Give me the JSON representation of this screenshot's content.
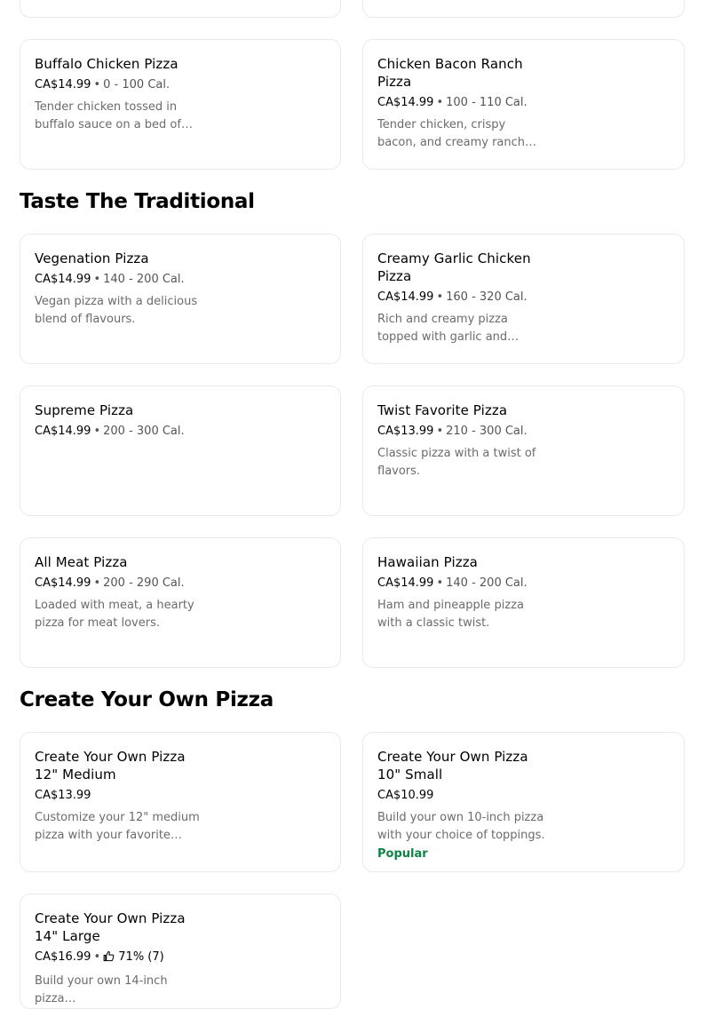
{
  "sections": {
    "traditional": {
      "title": "Taste The Traditional"
    },
    "create_own": {
      "title": "Create Your Own Pizza"
    }
  },
  "items": {
    "buffalo": {
      "name": "Buffalo Chicken Pizza",
      "price": "CA$14.99",
      "calories": "0 - 100 Cal.",
      "description": "Tender chicken tossed in buffalo sauce on a bed of…"
    },
    "bacon_ranch": {
      "name": "Chicken Bacon Ranch Pizza",
      "price": "CA$14.99",
      "calories": "100 - 110 Cal.",
      "description": "Tender chicken, crispy bacon, and creamy ranch…"
    },
    "vegenation": {
      "name": "Vegenation Pizza",
      "price": "CA$14.99",
      "calories": "140 - 200 Cal.",
      "description": "Vegan pizza with a delicious blend of flavours."
    },
    "creamy_garlic": {
      "name": "Creamy Garlic Chicken Pizza",
      "price": "CA$14.99",
      "calories": "160 - 320 Cal.",
      "description": "Rich and creamy pizza topped with garlic and…"
    },
    "supreme": {
      "name": "Supreme Pizza",
      "price": "CA$14.99",
      "calories": "200 - 300 Cal."
    },
    "twist": {
      "name": "Twist Favorite Pizza",
      "price": "CA$13.99",
      "calories": "210 - 300 Cal.",
      "description": "Classic pizza with a twist of flavors."
    },
    "all_meat": {
      "name": "All Meat Pizza",
      "price": "CA$14.99",
      "calories": "200 - 290 Cal.",
      "description": "Loaded with meat, a hearty pizza for meat lovers."
    },
    "hawaiian": {
      "name": "Hawaiian Pizza",
      "price": "CA$14.99",
      "calories": "140 - 200 Cal.",
      "description": "Ham and pineapple pizza with a classic twist."
    },
    "cyo_medium": {
      "name": "Create Your Own Pizza 12\" Medium",
      "price": "CA$13.99",
      "description": "Customize your 12\" medium pizza with your favorite…"
    },
    "cyo_small": {
      "name": "Create Your Own Pizza 10\" Small",
      "price": "CA$10.99",
      "description": "Build your own 10-inch pizza with your choice of toppings.",
      "badge": "Popular"
    },
    "cyo_large": {
      "name": "Create Your Own Pizza 14\" Large",
      "price": "CA$16.99",
      "rating": "71% (7)",
      "description": "Build your own 14-inch pizza…"
    }
  },
  "meta": {
    "separator": "•",
    "rating_icon": "thumbs-up-icon",
    "badge_color": "#0e8345"
  }
}
